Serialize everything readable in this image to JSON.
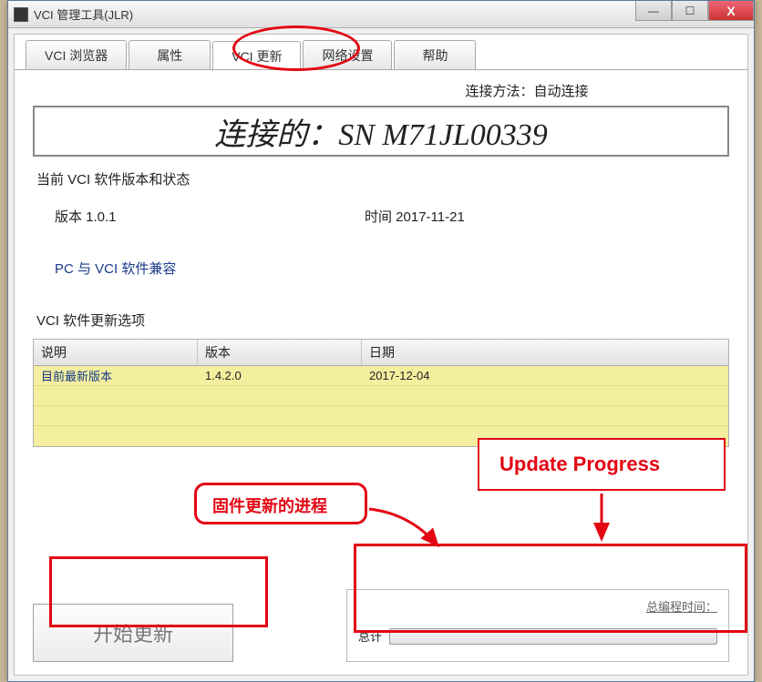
{
  "window": {
    "title": "VCI 管理工具(JLR)"
  },
  "tabs": {
    "browser": "VCI 浏览器",
    "properties": "属性",
    "update": "VCI 更新",
    "network": "网络设置",
    "help": "帮助"
  },
  "connection": {
    "method_label": "连接方法：自动连接",
    "banner": "连接的：SN M71JL00339"
  },
  "current": {
    "section_title": "当前 VCI 软件版本和状态",
    "version_label": "版本 1.0.1",
    "time_label": "时间 2017-11-21",
    "compat_text": "PC 与 VCI 软件兼容"
  },
  "options": {
    "title": "VCI 软件更新选项",
    "headers": {
      "desc": "说明",
      "ver": "版本",
      "date": "日期"
    },
    "row": {
      "desc": "目前最新版本",
      "ver": "1.4.2.0",
      "date": "2017-12-04"
    }
  },
  "actions": {
    "start_update": "开始更新"
  },
  "progress": {
    "time_label": "总编程时间：",
    "total_label": "总计"
  },
  "annotations": {
    "cn": "固件更新的进程",
    "en": "Update Progress"
  }
}
